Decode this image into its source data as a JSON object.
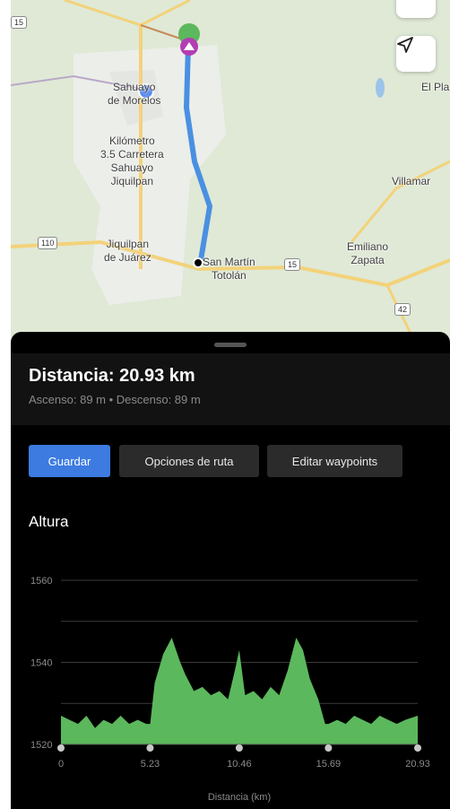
{
  "map": {
    "labels": {
      "sahuayo": "Sahuayo\nde Morelos",
      "kilometro": "Kilómetro\n3.5 Carretera\nSahuayo\nJiquilpan",
      "jiquilpan": "Jiquilpan\nde Juárez",
      "sanmartin": "San Martín\nTotolán",
      "emiliano": "Emiliano\nZapata",
      "villamar": "Villamar",
      "elpla": "El Pla"
    },
    "shields": {
      "r15a": "15",
      "r110": "110",
      "r15b": "15",
      "r42": "42"
    },
    "locate_icon": "navigation-arrow-icon"
  },
  "summary": {
    "distance": "Distancia: 20.93 km",
    "elevation": "Ascenso: 89 m • Descenso: 89 m"
  },
  "buttons": {
    "save": "Guardar",
    "route_options": "Opciones de ruta",
    "edit_waypoints": "Editar waypoints"
  },
  "colors": {
    "accent": "#3d7be0",
    "route": "#4a90e2",
    "profile_fill": "#5cb85c"
  },
  "chart_data": {
    "type": "area",
    "title": "Altura",
    "xlabel": "Distancia (km)",
    "ylabel": "",
    "yticks": [
      "1560",
      "1540",
      "1520"
    ],
    "xticks": [
      "0",
      "5.23",
      "10.46",
      "15.69",
      "20.93"
    ],
    "xlim": [
      0,
      20.93
    ],
    "ylim": [
      1520,
      1560
    ],
    "x": [
      0,
      0.5,
      1,
      1.5,
      2,
      2.5,
      3,
      3.5,
      4,
      4.5,
      5,
      5.23,
      5.5,
      6,
      6.5,
      7,
      7.3,
      7.8,
      8.3,
      8.8,
      9.3,
      9.8,
      10.2,
      10.46,
      10.8,
      11.3,
      11.8,
      12.3,
      12.8,
      13.3,
      13.8,
      14.2,
      14.6,
      15.1,
      15.5,
      15.69,
      16.2,
      16.7,
      17.2,
      17.7,
      18.2,
      18.7,
      19.2,
      19.7,
      20.2,
      20.93
    ],
    "y": [
      1527,
      1526,
      1525,
      1527,
      1524,
      1526,
      1525,
      1527,
      1525,
      1526,
      1525,
      1525,
      1535,
      1542,
      1546,
      1540,
      1537,
      1533,
      1534,
      1532,
      1533,
      1531,
      1538,
      1543,
      1532,
      1533,
      1531,
      1534,
      1532,
      1538,
      1546,
      1543,
      1536,
      1531,
      1525,
      1525,
      1526,
      1525,
      1527,
      1526,
      1525,
      1527,
      1526,
      1525,
      1526,
      1527
    ]
  }
}
